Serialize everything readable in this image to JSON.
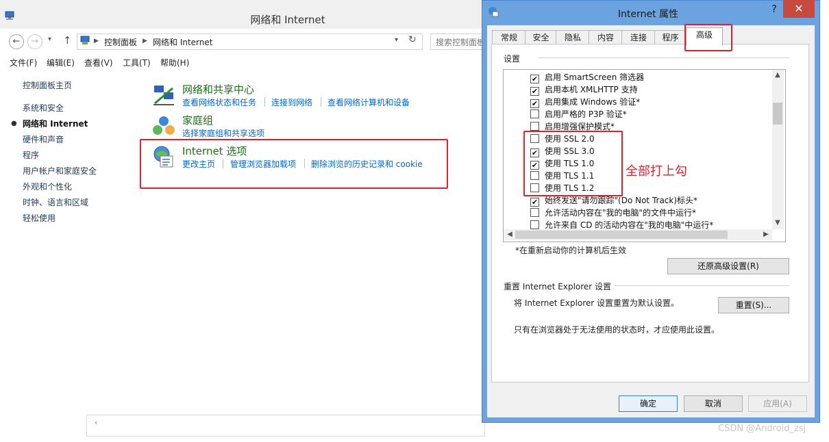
{
  "control_panel": {
    "title": "网络和 Internet",
    "breadcrumb": [
      "控制面板",
      "网络和 Internet"
    ],
    "search_placeholder": "搜索控制面板",
    "menu": [
      "文件(F)",
      "编辑(E)",
      "查看(V)",
      "工具(T)",
      "帮助(H)"
    ],
    "sidebar": [
      {
        "label": "控制面板主页"
      },
      {
        "label": "系统和安全"
      },
      {
        "label": "网络和 Internet"
      },
      {
        "label": "硬件和声音"
      },
      {
        "label": "程序"
      },
      {
        "label": "用户帐户和家庭安全"
      },
      {
        "label": "外观和个性化"
      },
      {
        "label": "时钟、语言和区域"
      },
      {
        "label": "轻松使用"
      }
    ],
    "sections": [
      {
        "title": "网络和共享中心",
        "links": [
          "查看网络状态和任务",
          "连接到网络",
          "查看网络计算机和设备"
        ]
      },
      {
        "title": "家庭组",
        "links": [
          "选择家庭组和共享选项"
        ]
      },
      {
        "title": "Internet 选项",
        "links": [
          "更改主页",
          "管理浏览器加载项",
          "删除浏览的历史记录和 cookie"
        ]
      }
    ]
  },
  "dialog": {
    "title": "Internet 属性",
    "help": "?",
    "close": "✕",
    "tabs": [
      "常规",
      "安全",
      "隐私",
      "内容",
      "连接",
      "程序",
      "高级"
    ],
    "settings_group_label": "设置",
    "options": [
      {
        "label": "启用 SmartScreen 筛选器",
        "checked": true
      },
      {
        "label": "启用本机 XMLHTTP 支持",
        "checked": true
      },
      {
        "label": "启用集成 Windows 验证*",
        "checked": true
      },
      {
        "label": "启用严格的 P3P 验证*",
        "checked": false
      },
      {
        "label": "启用增强保护模式*",
        "checked": false
      },
      {
        "label": "使用 SSL 2.0",
        "checked": false
      },
      {
        "label": "使用 SSL 3.0",
        "checked": true
      },
      {
        "label": "使用 TLS 1.0",
        "checked": true
      },
      {
        "label": "使用 TLS 1.1",
        "checked": false
      },
      {
        "label": "使用 TLS 1.2",
        "checked": false
      },
      {
        "label": "始终发送\"请勿跟踪\"(Do Not Track)标头*",
        "checked": true
      },
      {
        "label": "允许活动内容在\"我的电脑\"的文件中运行*",
        "checked": false
      },
      {
        "label": "允许来自 CD 的活动内容在\"我的电脑\"中运行*",
        "checked": false
      }
    ],
    "restart_note": "*在重新启动你的计算机后生效",
    "restore_button": "还原高级设置(R)",
    "reset_group_label": "重置 Internet Explorer 设置",
    "reset_desc": "将 Internet Explorer 设置重置为默认设置。",
    "reset_button": "重置(S)...",
    "reset_note": "只有在浏览器处于无法使用的状态时，才应使用此设置。",
    "ok": "确定",
    "cancel": "取消",
    "apply": "应用(A)"
  },
  "annotation": {
    "text": "全部打上勾",
    "color": "#e0202a"
  },
  "watermark": "CSDN @Android_zsj"
}
